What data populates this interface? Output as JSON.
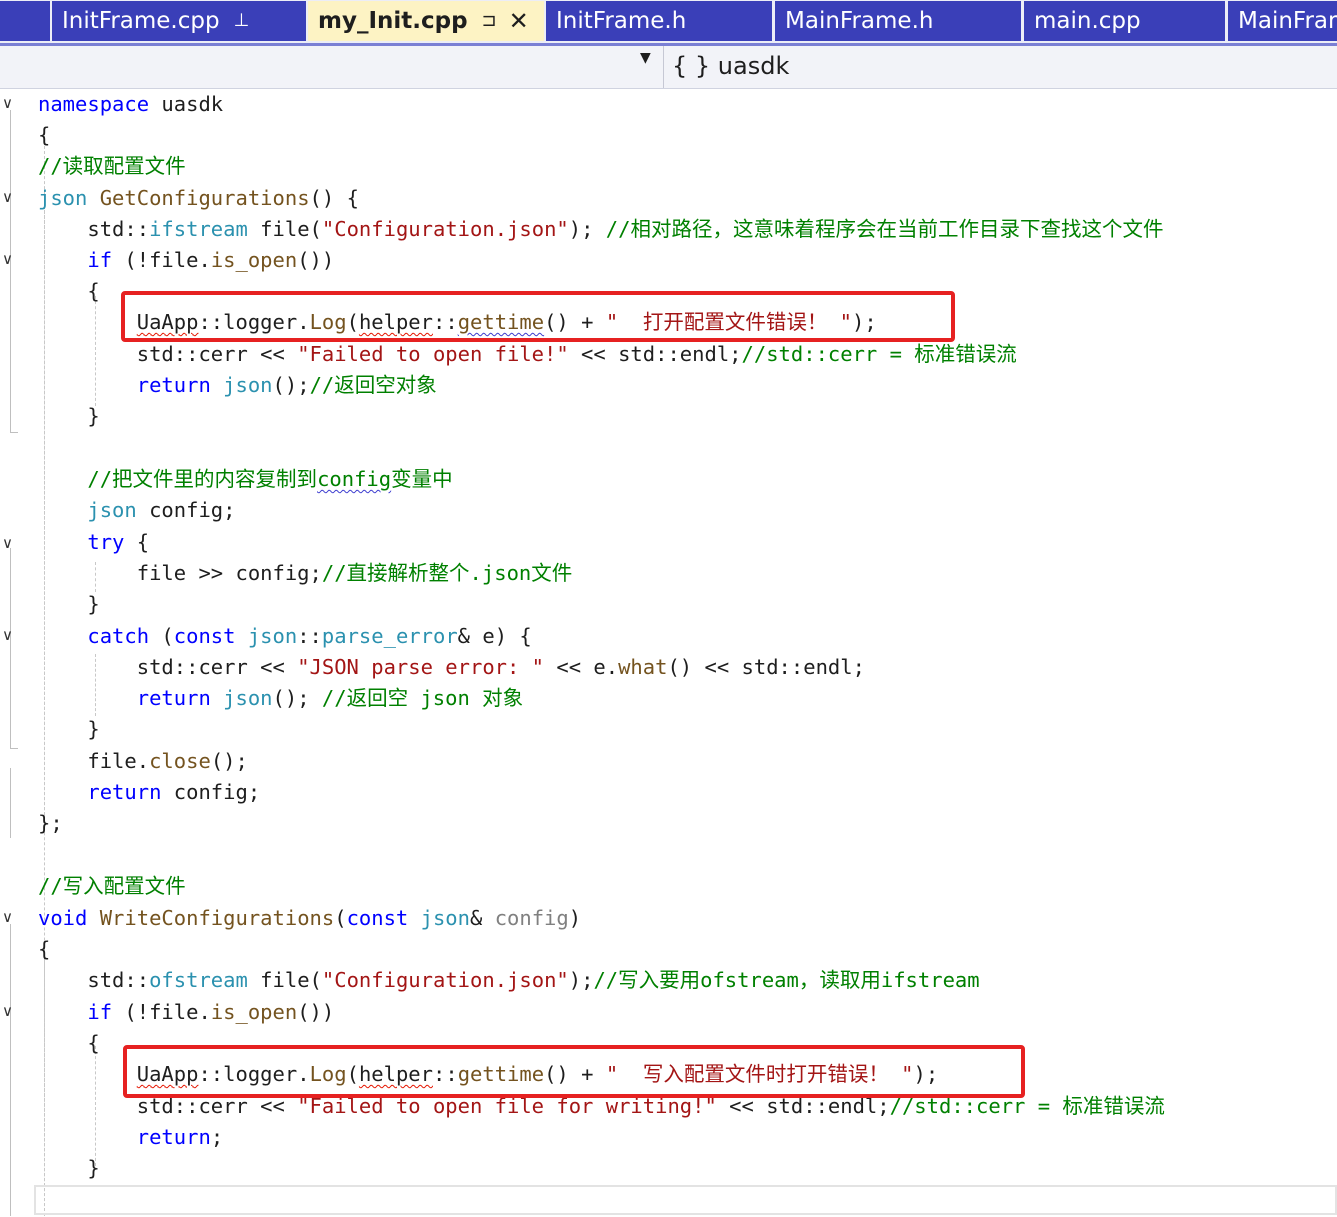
{
  "tabs": [
    {
      "label": "InitFrame.cpp",
      "pin": "⊥",
      "active": false
    },
    {
      "label": "my_Init.cpp",
      "pin": "⊐",
      "close": "✕",
      "active": true
    },
    {
      "label": "InitFrame.h"
    },
    {
      "label": "MainFrame.h"
    },
    {
      "label": "main.cpp"
    },
    {
      "label": "MainFrame.h"
    }
  ],
  "navbar": {
    "scope": "{ } uasdk",
    "dropdown_arrow": "▼"
  },
  "fold_glyph": "∨",
  "code": {
    "l01": [
      "namespace",
      " uasdk"
    ],
    "l02": [
      "{"
    ],
    "l03": [
      "//读取配置文件"
    ],
    "l04": [
      "json",
      " ",
      "GetConfigurations",
      "() {"
    ],
    "l05": [
      "    std::",
      "ifstream",
      " file(",
      "\"Configuration.json\"",
      "); ",
      "//相对路径，这意味着程序会在当前工作目录下查找这个文件"
    ],
    "l06": [
      "    ",
      "if",
      " (!file.",
      "is_open",
      "())"
    ],
    "l07": [
      "    {"
    ],
    "l08": [
      "        ",
      "UaApp",
      "::logger.",
      "Log",
      "(",
      "helper",
      "::",
      "gettime",
      "() + ",
      "\"  打开配置文件错误！ \"",
      ");"
    ],
    "l09": [
      "        std::cerr << ",
      "\"Failed to open file!\"",
      " << std::endl;",
      "//std::cerr = 标准错误流"
    ],
    "l10": [
      "        ",
      "return",
      " ",
      "json",
      "();",
      "//返回空对象"
    ],
    "l11": [
      "    }"
    ],
    "l12": [
      "    ",
      "//把文件里的内容复制到",
      "config",
      "变量中"
    ],
    "l13": [
      "    ",
      "json",
      " config;"
    ],
    "l14": [
      "    ",
      "try",
      " {"
    ],
    "l15": [
      "        file >> config;",
      "//直接解析整个.json文件"
    ],
    "l16": [
      "    }"
    ],
    "l17": [
      "    ",
      "catch",
      " (",
      "const",
      " ",
      "json",
      "::",
      "parse_error",
      "& e) {"
    ],
    "l18": [
      "        std::cerr << ",
      "\"JSON parse error: \"",
      " << e.",
      "what",
      "() << std::endl;"
    ],
    "l19": [
      "        ",
      "return",
      " ",
      "json",
      "(); ",
      "//返回空 json 对象"
    ],
    "l20": [
      "    }"
    ],
    "l21": [
      "    file.",
      "close",
      "();"
    ],
    "l22": [
      "    ",
      "return",
      " config;"
    ],
    "l23": [
      "};"
    ],
    "l24": [
      "//写入配置文件"
    ],
    "l25": [
      "void",
      " ",
      "WriteConfigurations",
      "(",
      "const",
      " ",
      "json",
      "& ",
      "config",
      ")"
    ],
    "l26": [
      "{"
    ],
    "l27": [
      "    std::",
      "ofstream",
      " file(",
      "\"Configuration.json\"",
      ");",
      "//写入要用ofstream，读取用ifstream"
    ],
    "l28": [
      "    ",
      "if",
      " (!file.",
      "is_open",
      "())"
    ],
    "l29": [
      "    {"
    ],
    "l30": [
      "        ",
      "UaApp",
      "::logger.",
      "Log",
      "(",
      "helper",
      "::",
      "gettime",
      "() + ",
      "\"  写入配置文件时打开错误！ \"",
      ");"
    ],
    "l31": [
      "        std::cerr << ",
      "\"Failed to open file for writing!\"",
      " << std::endl;",
      "//std::cerr = 标准错误流"
    ],
    "l32": [
      "        ",
      "return",
      ";"
    ],
    "l33": [
      "    }"
    ]
  },
  "colors": {
    "keyword": "#0000ff",
    "type": "#2b91af",
    "function": "#74531f",
    "string": "#a31515",
    "comment": "#008000",
    "highlight_box": "#e62121",
    "active_tab": "#fdf3c4",
    "inactive_tab": "#3a3fb8"
  }
}
